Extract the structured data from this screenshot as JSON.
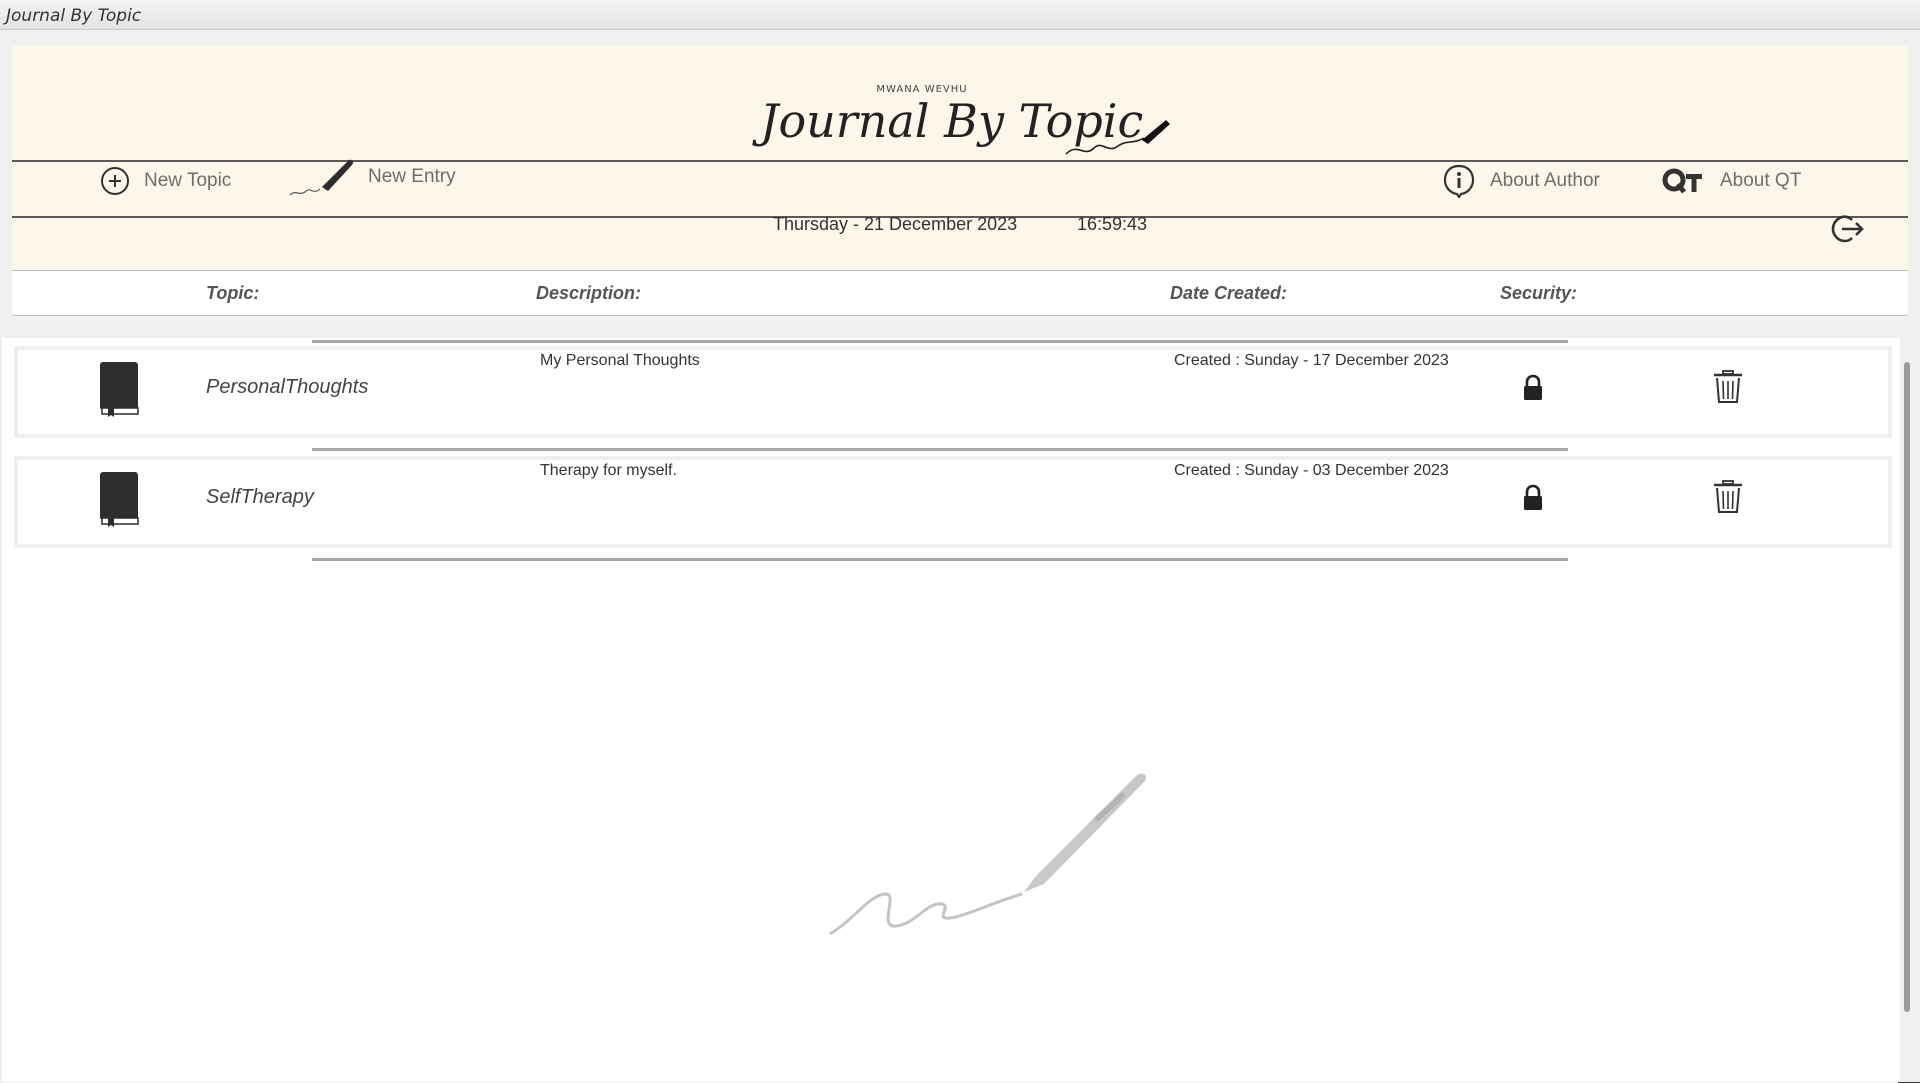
{
  "window": {
    "title": "Journal By Topic"
  },
  "header": {
    "brand_subtitle": "MWANA WEVHU",
    "brand_title": "Journal By Topic"
  },
  "toolbar": {
    "new_topic": "New Topic",
    "new_entry": "New Entry",
    "about_author": "About Author",
    "about_qt": "About QT"
  },
  "status": {
    "date": "Thursday - 21 December 2023",
    "time": "16:59:43"
  },
  "columns": {
    "topic": "Topic:",
    "description": "Description:",
    "date_created": "Date Created:",
    "security": "Security:"
  },
  "topics": [
    {
      "name": "PersonalThoughts",
      "description": "My Personal Thoughts",
      "created": "Created : Sunday - 17 December 2023",
      "locked": true
    },
    {
      "name": "SelfTherapy",
      "description": "Therapy for myself.",
      "created": "Created : Sunday - 03 December 2023",
      "locked": true
    }
  ],
  "icons": {
    "new_topic": "plus-circle-icon",
    "new_entry": "pen-icon",
    "about_author": "info-bubble-icon",
    "about_qt": "qt-logo-icon",
    "logout": "logout-icon",
    "book": "book-icon",
    "lock": "lock-icon",
    "delete": "trash-icon"
  },
  "colors": {
    "header_bg": "#fdf6ea",
    "text_muted": "#6e6e6e",
    "icon_dark": "#333333"
  }
}
